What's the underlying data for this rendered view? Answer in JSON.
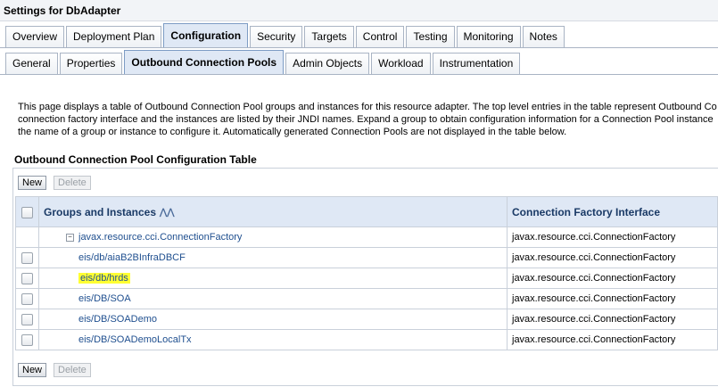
{
  "header": {
    "title": "Settings for DbAdapter"
  },
  "tabs_primary": [
    {
      "label": "Overview"
    },
    {
      "label": "Deployment Plan"
    },
    {
      "label": "Configuration",
      "active": true
    },
    {
      "label": "Security"
    },
    {
      "label": "Targets"
    },
    {
      "label": "Control"
    },
    {
      "label": "Testing"
    },
    {
      "label": "Monitoring"
    },
    {
      "label": "Notes"
    }
  ],
  "tabs_secondary": [
    {
      "label": "General"
    },
    {
      "label": "Properties"
    },
    {
      "label": "Outbound Connection Pools",
      "active": true
    },
    {
      "label": "Admin Objects"
    },
    {
      "label": "Workload"
    },
    {
      "label": "Instrumentation"
    }
  ],
  "description": [
    "This page displays a table of Outbound Connection Pool groups and instances for this resource adapter. The top level entries in the table represent Outbound Co",
    "connection factory interface and the instances are listed by their JNDI names. Expand a group to obtain configuration information for a Connection Pool instance",
    "the name of a group or instance to configure it. Automatically generated Connection Pools are not displayed in the table below."
  ],
  "section": {
    "title": "Outbound Connection Pool Configuration Table"
  },
  "buttons": {
    "new": "New",
    "delete": "Delete"
  },
  "table": {
    "headers": {
      "groups": "Groups and Instances",
      "interface": "Connection Factory Interface"
    },
    "group": {
      "name": "javax.resource.cci.ConnectionFactory",
      "interface": "javax.resource.cci.ConnectionFactory",
      "expander": "−"
    },
    "rows": [
      {
        "name": "eis/db/aiaB2BInfraDBCF",
        "interface": "javax.resource.cci.ConnectionFactory"
      },
      {
        "name": "eis/db/hrds",
        "interface": "javax.resource.cci.ConnectionFactory",
        "highlight": true
      },
      {
        "name": "eis/DB/SOA",
        "interface": "javax.resource.cci.ConnectionFactory"
      },
      {
        "name": "eis/DB/SOADemo",
        "interface": "javax.resource.cci.ConnectionFactory"
      },
      {
        "name": "eis/DB/SOADemoLocalTx",
        "interface": "javax.resource.cci.ConnectionFactory"
      }
    ]
  }
}
